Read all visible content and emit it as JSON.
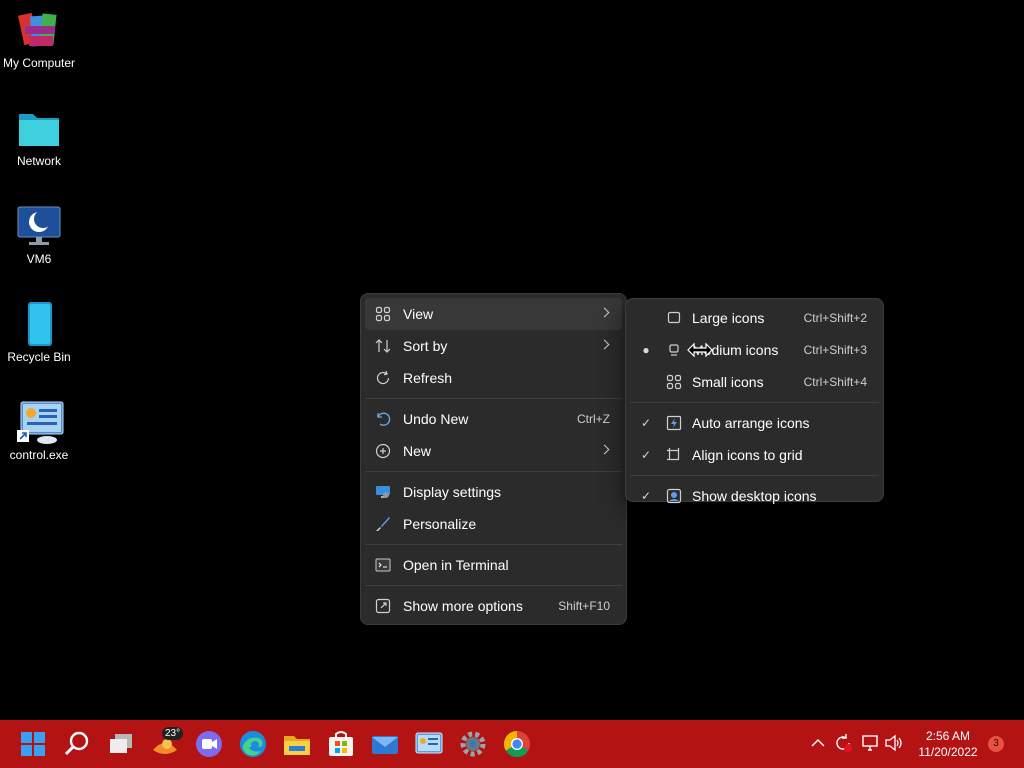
{
  "desktop_icons": [
    {
      "label": "My Computer",
      "icon": "winrar-books-icon"
    },
    {
      "label": "Network",
      "icon": "folder-icon"
    },
    {
      "label": "VM6",
      "icon": "monitor-icon"
    },
    {
      "label": "Recycle Bin",
      "icon": "recycle-bin-icon"
    },
    {
      "label": "control.exe",
      "icon": "control-panel-shortcut-icon"
    }
  ],
  "context_menu": {
    "view": {
      "label": "View"
    },
    "sort_by": {
      "label": "Sort by"
    },
    "refresh": {
      "label": "Refresh"
    },
    "undo": {
      "label": "Undo New",
      "shortcut": "Ctrl+Z"
    },
    "new": {
      "label": "New"
    },
    "display_settings": {
      "label": "Display settings"
    },
    "personalize": {
      "label": "Personalize"
    },
    "terminal": {
      "label": "Open in Terminal"
    },
    "more_options": {
      "label": "Show more options",
      "shortcut": "Shift+F10"
    }
  },
  "view_submenu": {
    "large": {
      "label": "Large icons",
      "shortcut": "Ctrl+Shift+2"
    },
    "medium": {
      "label": "Medium icons",
      "shortcut": "Ctrl+Shift+3",
      "selected": true
    },
    "small": {
      "label": "Small icons",
      "shortcut": "Ctrl+Shift+4"
    },
    "auto_arrange": {
      "label": "Auto arrange icons",
      "checked": true
    },
    "align_grid": {
      "label": "Align icons to grid",
      "checked": true
    },
    "show_desktop": {
      "label": "Show desktop icons",
      "checked": true
    }
  },
  "taskbar": {
    "weather_temp": "23°",
    "clock_time": "2:56 AM",
    "clock_date": "11/20/2022",
    "notification_count": "3",
    "accent": "#b31313"
  }
}
